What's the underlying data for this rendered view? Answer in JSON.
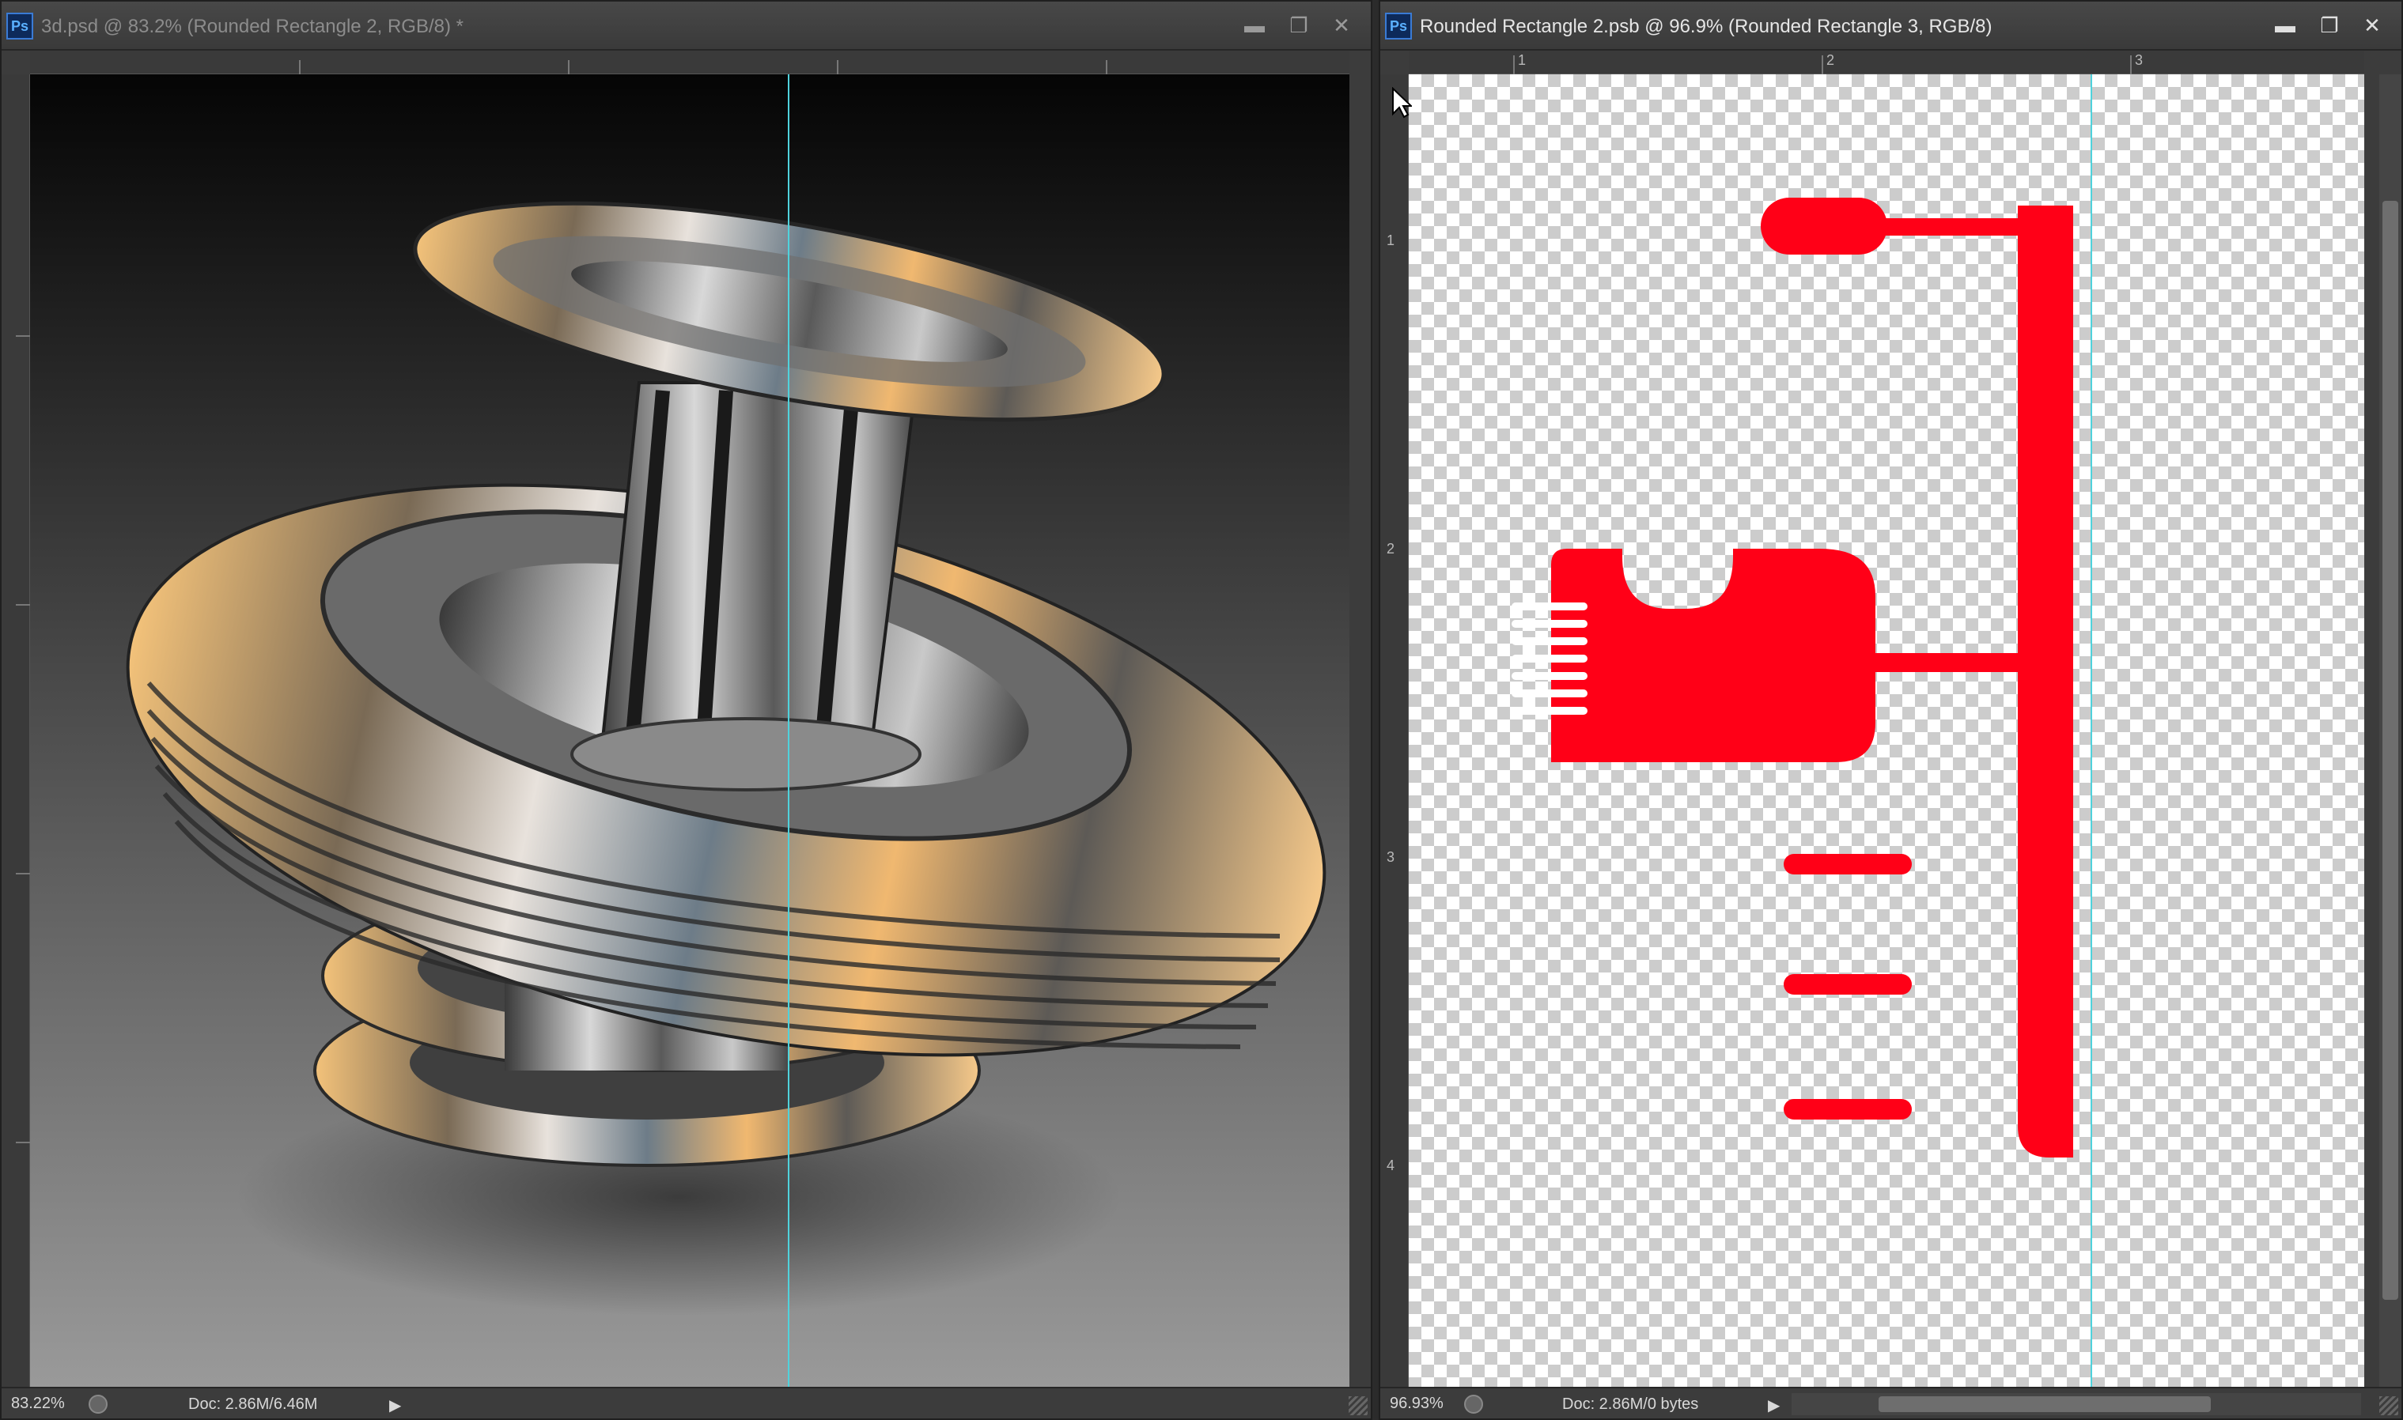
{
  "windows": {
    "left": {
      "title": "3d.psd @ 83.2% (Rounded Rectangle 2, RGB/8) *",
      "status": {
        "zoom": "83.22%",
        "doc": "Doc: 2.86M/6.46M"
      }
    },
    "right": {
      "title": "Rounded Rectangle 2.psb @ 96.9% (Rounded Rectangle 3, RGB/8)",
      "status": {
        "zoom": "96.93%",
        "doc": "Doc: 2.86M/0 bytes"
      }
    }
  },
  "app_icon": "Ps",
  "window_buttons": {
    "minimize": "▬",
    "restore": "❐",
    "close": "✕"
  },
  "rulers": {
    "right_h": [
      "1",
      "2",
      "3"
    ],
    "right_v": [
      "1",
      "2",
      "3",
      "4"
    ]
  },
  "colors": {
    "shape_fill": "#ff0017",
    "guide": "#4fd2dc"
  },
  "icons": [
    "ps-app-icon",
    "minimize-icon",
    "restore-icon",
    "close-icon",
    "status-info-icon",
    "play-arrow-icon",
    "resize-grip-icon",
    "arrow-cursor-icon"
  ]
}
